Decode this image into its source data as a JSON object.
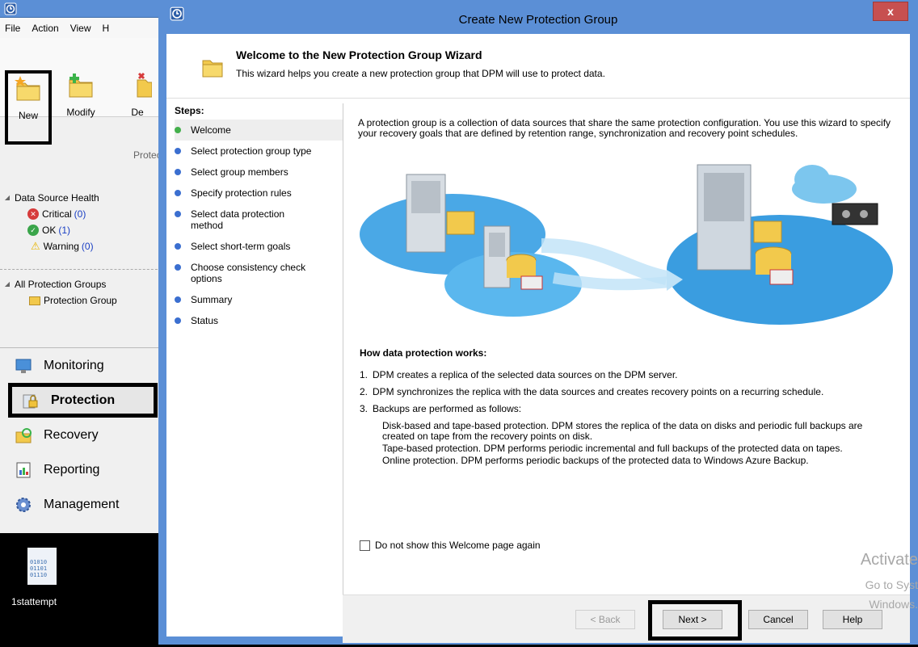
{
  "console": {
    "menu": [
      "File",
      "Action",
      "View",
      "H"
    ],
    "ribbon": {
      "new_label": "New",
      "modify_label": "Modify",
      "delete_label": "De",
      "group_label": "Protect"
    },
    "health": {
      "header": "Data Source Health",
      "critical_label": "Critical",
      "critical_count": "(0)",
      "ok_label": "OK",
      "ok_count": "(1)",
      "warning_label": "Warning",
      "warning_count": "(0)"
    },
    "groups": {
      "header": "All Protection Groups",
      "item": "Protection Group"
    },
    "nav": [
      "Monitoring",
      "Protection",
      "Recovery",
      "Reporting",
      "Management"
    ]
  },
  "desktop": {
    "icon_label": "1stattempt",
    "file_glyph": "01010\n01101\n01110"
  },
  "dialog": {
    "title": "Create New Protection Group",
    "close_glyph": "x",
    "header_title": "Welcome to the New Protection Group Wizard",
    "header_subtitle": "This wizard helps you create a new protection group that DPM will use to protect data.",
    "steps_title": "Steps:",
    "steps": [
      "Welcome",
      "Select protection group type",
      "Select group members",
      "Specify protection rules",
      "Select data protection method",
      "Select short-term goals",
      "Choose consistency check options",
      "Summary",
      "Status"
    ],
    "intro": "A protection group is a collection of data sources that share the same protection configuration. You use this wizard to specify your recovery goals that are defined by retention range, synchronization and recovery point schedules.",
    "how_title": "How data protection works:",
    "how_items": [
      "DPM creates a replica of the selected data sources on the DPM server.",
      "DPM synchronizes the replica with the data sources and creates recovery points on a recurring schedule.",
      "Backups are performed as follows:"
    ],
    "how_numbers": [
      "1.",
      "2.",
      "3."
    ],
    "backup_details": [
      "Disk-based and tape-based protection. DPM stores the replica of the data on disks and periodic full backups are created on tape from the recovery points on disk.",
      "Tape-based protection. DPM performs periodic incremental and full backups of the protected data on tapes.",
      "Online protection. DPM performs periodic backups of the protected data to Windows Azure Backup."
    ],
    "checkbox_label": "Do not show this Welcome page again",
    "buttons": {
      "back": "< Back",
      "next": "Next >",
      "cancel": "Cancel",
      "help": "Help"
    }
  },
  "watermark": {
    "line1": "Activate",
    "line2": "Go to Syst",
    "line3": "Windows."
  },
  "colors": {
    "titlebar": "#5b8fd6",
    "step_current": "#44b04c",
    "step_dot": "#3b6fd0",
    "critical": "#d63b3b",
    "ok": "#3aa54a",
    "warning": "#e8b400"
  }
}
